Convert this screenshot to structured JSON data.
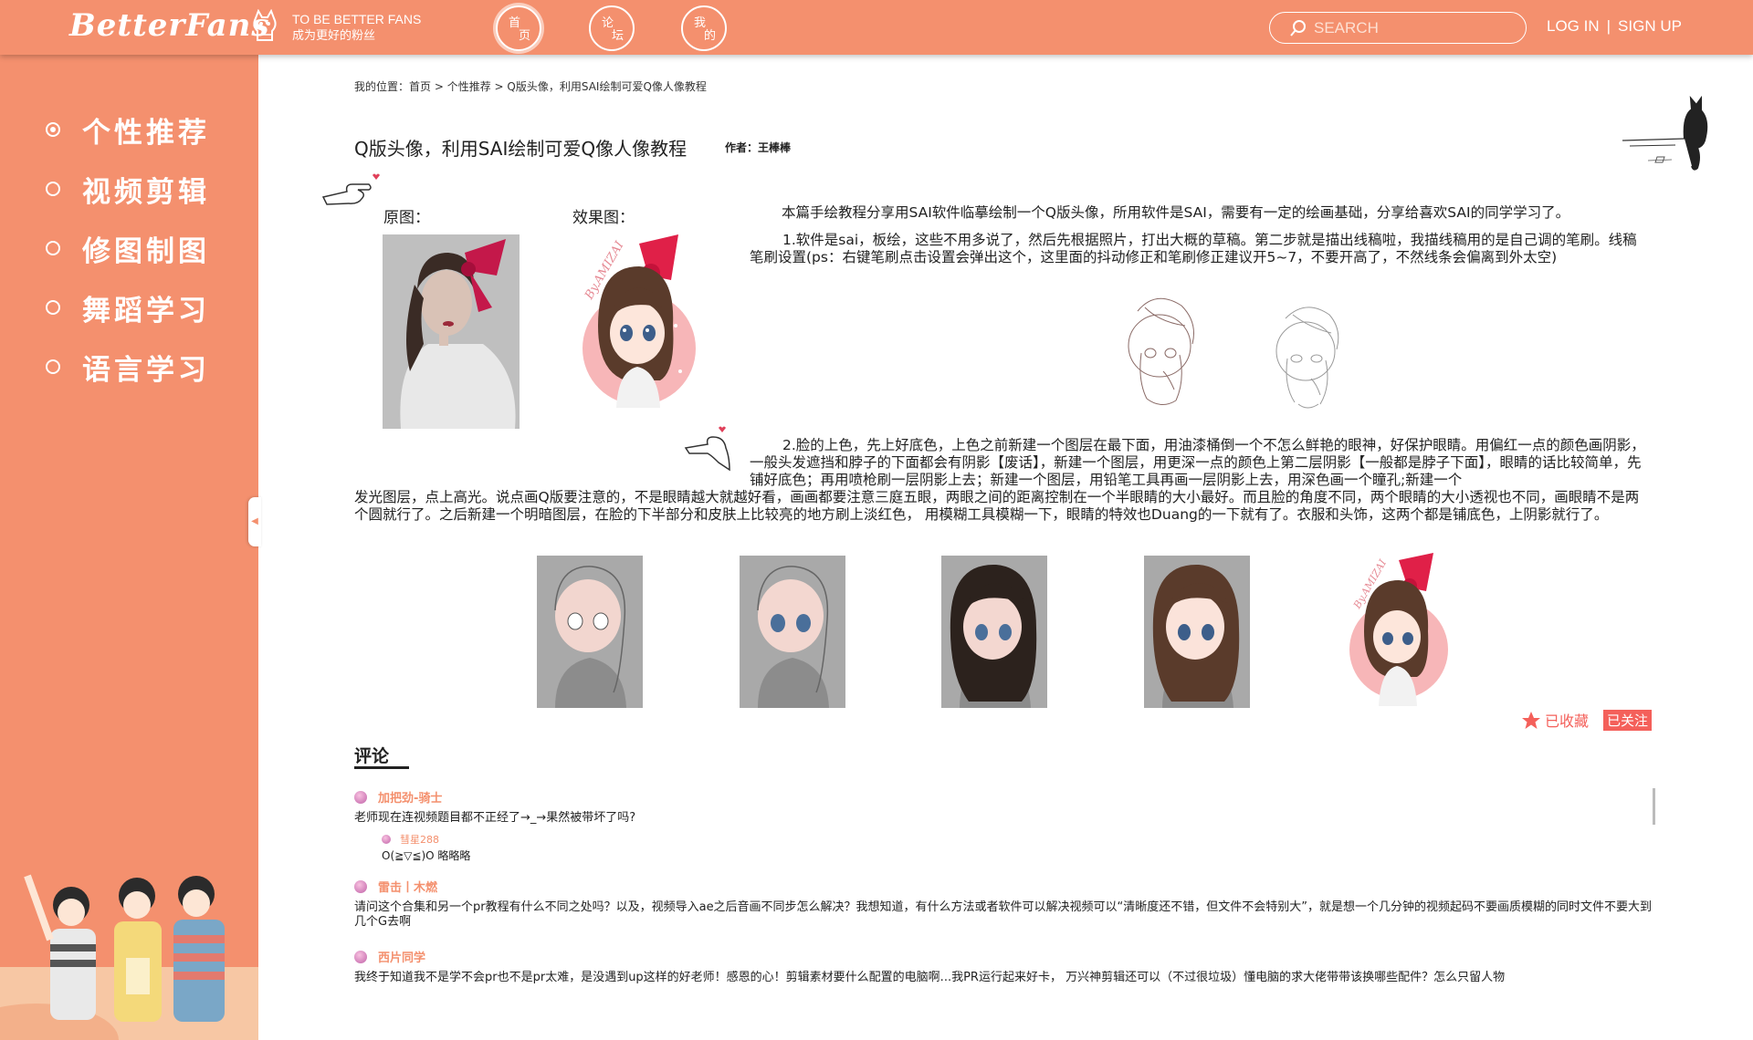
{
  "header": {
    "logo": "BetterFans",
    "slogan_en": "TO BE BETTER FANS",
    "slogan_cn": "成为更好的粉丝",
    "nav": [
      {
        "a": "首",
        "b": "页"
      },
      {
        "a": "论",
        "b": "坛"
      },
      {
        "a": "我",
        "b": "的"
      }
    ],
    "search_placeholder": "SEARCH",
    "login": "LOG IN",
    "separator": "|",
    "signup": "SIGN UP",
    "accent_color": "#f4906e"
  },
  "sidebar": {
    "items": [
      {
        "label": "个性推荐"
      },
      {
        "label": "视频剪辑"
      },
      {
        "label": "修图制图"
      },
      {
        "label": "舞蹈学习"
      },
      {
        "label": "语言学习"
      }
    ]
  },
  "breadcrumb": {
    "prefix": "我的位置：",
    "home": "首页",
    "sep": " > ",
    "category": "个性推荐",
    "current": "Q版头像，利用SAI绘制可爱Q像人像教程"
  },
  "article": {
    "title": "Q版头像，利用SAI绘制可爱Q像人像教程",
    "author": "作者：王棒棒",
    "original_label": "原图：",
    "result_label": "效果图：",
    "intro": "本篇手绘教程分享用SAI软件临摹绘制一个Q版头像，所用软件是SAI，需要有一定的绘画基础，分享给喜欢SAI的同学学习了。",
    "step1": "1.软件是sai，板绘，这些不用多说了，然后先根据照片，打出大概的草稿。第二步就是描出线稿啦，我描线稿用的是自己调的笔刷。线稿笔刷设置(ps：右键笔刷点击设置会弹出这个，这里面的抖动修正和笔刷修正建议开5~7，不要开高了，不然线条会偏离到外太空)",
    "step2_a": "2.脸的上色，先上好底色，上色之前新建一个图层在最下面，用油漆桶倒一个不怎么鲜艳的眼神，好保护眼睛。用偏红一点的颜色画阴影，一般头发遮挡和脖子的下面都会有阴影【废话】，新建一个图层，用更深一点的颜色上第二层阴影【一般都是脖子下面】，眼睛的话比较简单，先铺好底色；再用喷枪刷一层阴影上去；新建一个图层，用铅笔工具再画一层阴影上去，用深色画一个瞳孔;新建一个",
    "step2_b": "发光图层，点上高光。说点画Q版要注意的，不是眼睛越大就越好看，画画都要注意三庭五眼，两眼之间的距离控制在一个半眼睛的大小最好。而且脸的角度不同，两个眼睛的大小透视也不同，画眼睛不是两个圆就行了。之后新建一个明暗图层，在脸的下半部分和皮肤上比较亮的地方刷上淡红色，  用模糊工具模糊一下，眼睛的特效也Duang的一下就有了。衣服和头饰，这两个都是铺底色，上阴影就行了。",
    "signature": "By.AMIZAI",
    "favorite": "已收藏",
    "follow": "已关注"
  },
  "comments": {
    "heading": "评论",
    "list": [
      {
        "name": "加把劲-骑士",
        "text": "老师现在连视频题目都不正经了→_→果然被带坏了吗?",
        "reply_name": "彗星288",
        "reply_text": "O(≧▽≦)O 略略略"
      },
      {
        "name": "雷击丨木燃",
        "text": "请问这个合集和另一个pr教程有什么不同之处吗？以及，视频导入ae之后音画不同步怎么解决？我想知道，有什么方法或者软件可以解决视频可以“清晰度还不错，但文件不会特别大”，就是想一个几分钟的视频起码不要画质模糊的同时文件不要大到几个G去啊"
      },
      {
        "name": "西片同学",
        "text": "我终于知道我不是学不会pr也不是pr太难，是没遇到up这样的好老师！感恩的心！剪辑素材要什么配置的电脑啊...我PR运行起来好卡，  万兴神剪辑还可以（不过很垃圾）懂电脑的求大佬带带该换哪些配件？怎么只留人物"
      }
    ]
  }
}
